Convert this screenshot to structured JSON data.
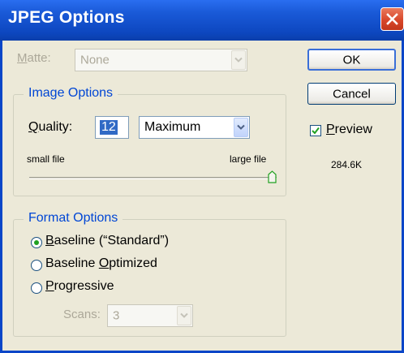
{
  "dialog": {
    "title": "JPEG Options",
    "matte": {
      "label": "Matte:",
      "value": "None",
      "enabled": false
    },
    "buttons": {
      "ok": "OK",
      "cancel": "Cancel"
    },
    "preview": {
      "label": "Preview",
      "checked": true,
      "size": "284.6K"
    }
  },
  "image_options": {
    "legend": "Image Options",
    "quality_label": "Quality:",
    "quality_value": "12",
    "quality_preset": "Maximum",
    "small_label": "small file",
    "large_label": "large file",
    "slider_fraction": 1.0
  },
  "format_options": {
    "legend": "Format Options",
    "choices": [
      {
        "label": "Baseline (“Standard”)",
        "selected": true
      },
      {
        "label": "Baseline Optimized",
        "selected": false
      },
      {
        "label": "Progressive",
        "selected": false
      }
    ],
    "scans_label": "Scans:",
    "scans_value": "3"
  },
  "colors": {
    "title_bar": "#0d47c0",
    "accent": "#0046d5",
    "face": "#ece9d8",
    "close": "#d8472a"
  }
}
